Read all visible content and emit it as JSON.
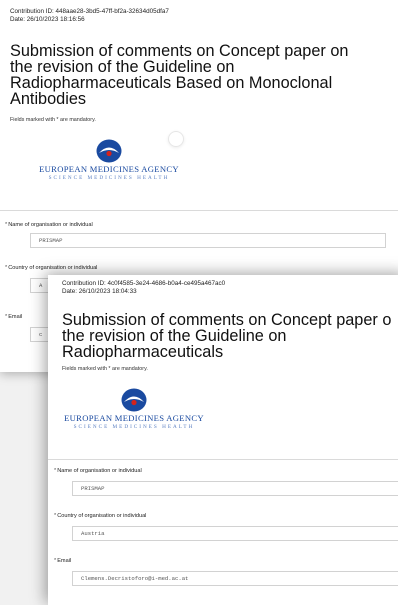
{
  "doc1": {
    "contribution_id": "Contribution ID: 448aae28-3bd5-47ff-bf2a-32634d05dfa7",
    "date": "Date: 26/10/2023 18:16:56",
    "title_lines": [
      "Submission of comments on Concept paper on",
      "the revision of the Guideline on",
      "Radiopharmaceuticals Based on Monoclonal",
      "Antibodies"
    ],
    "mandatory_note": "Fields marked with * are mandatory.",
    "logo": {
      "name": "EUROPEAN MEDICINES AGENCY",
      "tagline": "SCIENCE   MEDICINES   HEALTH"
    },
    "fields": [
      {
        "label": "Name of organisation or individual",
        "value": "PRISMAP"
      },
      {
        "label": "Country of organisation or individual",
        "value": "A"
      },
      {
        "label": "Email",
        "value": "c"
      }
    ]
  },
  "doc2": {
    "contribution_id": "Contribution ID: 4c0f4585-3e24-4686-b0a4-ce495a467ac0",
    "date": "Date: 26/10/2023 18:04:33",
    "title_lines": [
      "Submission of comments on Concept paper o",
      "the revision of the Guideline on",
      "Radiopharmaceuticals"
    ],
    "mandatory_note": "Fields marked with * are mandatory.",
    "logo": {
      "name": "EUROPEAN MEDICINES AGENCY",
      "tagline": "SCIENCE   MEDICINES   HEALTH"
    },
    "fields": [
      {
        "label": "Name of organisation or individual",
        "value": "PRISMAP"
      },
      {
        "label": "Country of organisation or individual",
        "value": "Austria"
      },
      {
        "label": "Email",
        "value": "Clemens.Decristoforo@i-med.ac.at"
      }
    ]
  },
  "required_marker": "*",
  "colors": {
    "logo_blue": "#1a4aa0",
    "logo_light_blue": "#5a7fc2",
    "logo_red": "#d4231c"
  }
}
